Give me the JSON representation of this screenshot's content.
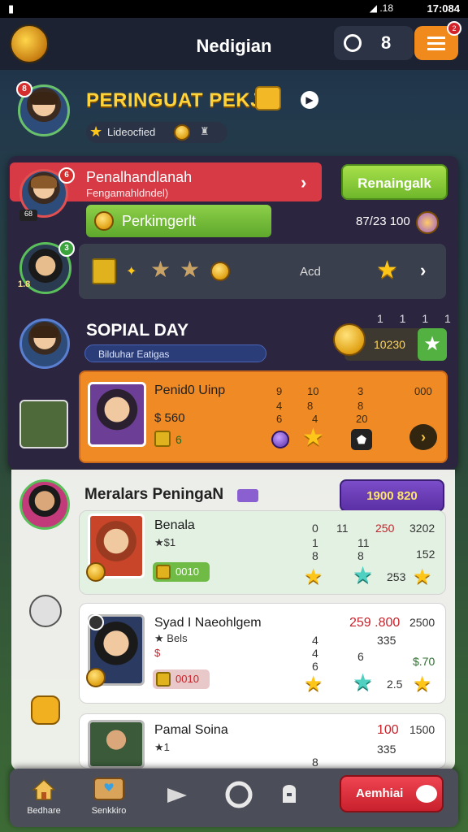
{
  "status_bar": {
    "left_icon": "notification-icon",
    "clock": "17:084",
    "signal": ".18"
  },
  "header": {
    "title": "Nedigian",
    "button_b": "8",
    "menu_badge": "2"
  },
  "profile": {
    "name": "PERINGUAT PEKJK",
    "league": "Lideocfied",
    "avatar_badge": "8"
  },
  "mail": {
    "title": "Penalhandlanah",
    "subtitle": "Fengamahldndel)",
    "action_button": "Renaingalk",
    "avatar_badge": "6",
    "avatar_tag": "68"
  },
  "progress": {
    "label": "Perkimgerlt",
    "gold_count": "87/23 100"
  },
  "rewards": {
    "avatar_badge": "3",
    "avatar_tag": "1.8",
    "add_label": "Acd"
  },
  "social": {
    "title": "SOPIAL DAY",
    "subtitle": "Bilduhar Eatigas",
    "score": "10230",
    "tally": "1 1 1 1"
  },
  "featured_card": {
    "name": "Penid0 Uinp",
    "value": "$ 560",
    "level": "6",
    "stats_col1": [
      "9",
      "4",
      "6"
    ],
    "stats_col2": [
      "10",
      "8",
      "4"
    ],
    "stats_col3": [
      "3",
      "8",
      "20"
    ],
    "stat_right": "000"
  },
  "lower": {
    "title": "Meralars PeningaN",
    "badge_text": "1900 820",
    "items": [
      {
        "name": "Benala",
        "sub": "$1",
        "tag": "0010",
        "col1": [
          "0",
          "1",
          "8"
        ],
        "col2": [
          "11",
          "11",
          "8"
        ],
        "col3_top": "250",
        "col4": [
          "3202",
          "152",
          "253"
        ]
      },
      {
        "name": "Syad I Naeohlgem",
        "sub": "Bels",
        "sub2": "$",
        "tag": "0010",
        "col1": [
          "4",
          "4",
          "6"
        ],
        "col3_top": "259 .800",
        "col3": [
          "335",
          "6"
        ],
        "col4": [
          "2500",
          "$.70",
          "2.5"
        ]
      },
      {
        "name": "Pamal Soina",
        "sub": "1",
        "col3_top": "100",
        "col3": [
          "335",
          "8"
        ],
        "col4": [
          "1500"
        ]
      }
    ]
  },
  "bottom_nav": {
    "items": [
      {
        "label": "Bedhare",
        "icon": "home-icon"
      },
      {
        "label": "Senkkiro",
        "icon": "map-icon"
      },
      {
        "label": "",
        "icon": "play-icon"
      },
      {
        "label": "",
        "icon": "settings-icon"
      },
      {
        "label": "",
        "icon": "chat-icon"
      }
    ],
    "cta": "Aemhiai"
  },
  "colors": {
    "accent_orange": "#f08a25",
    "accent_green": "#6fb82b",
    "accent_red": "#d83a45",
    "accent_purple": "#5b2fa5",
    "gold": "#ffc61a"
  }
}
